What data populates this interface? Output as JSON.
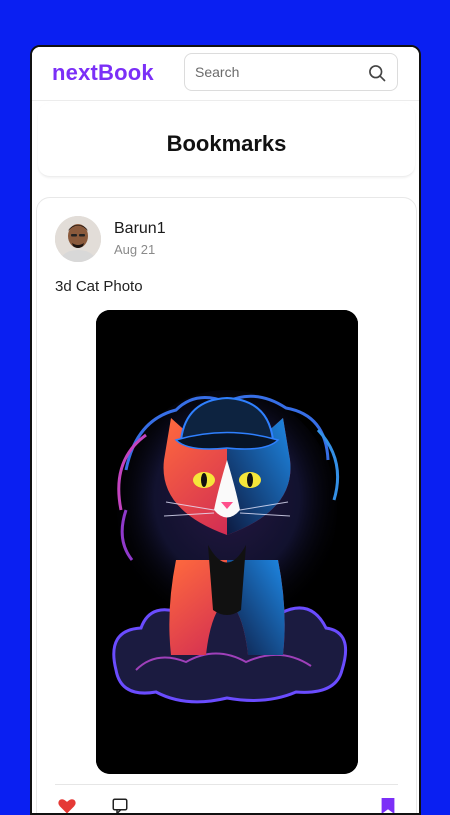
{
  "app": {
    "brand": "nextBook",
    "brand_color": "#7b2ff7",
    "background_color": "#0a1ff2"
  },
  "search": {
    "placeholder": "Search",
    "value": "",
    "icon": "search-icon"
  },
  "page": {
    "title": "Bookmarks"
  },
  "post": {
    "author": "Barun1",
    "date": "Aug 21",
    "caption": "3d Cat Photo",
    "image_subject": "neon cat wearing cap",
    "actions": [
      {
        "icon": "heart-icon",
        "color": "#e53935"
      },
      {
        "icon": "comment-icon",
        "color": "#222222"
      },
      {
        "icon": "bookmark-icon",
        "color": "#7b2ff7"
      }
    ]
  }
}
